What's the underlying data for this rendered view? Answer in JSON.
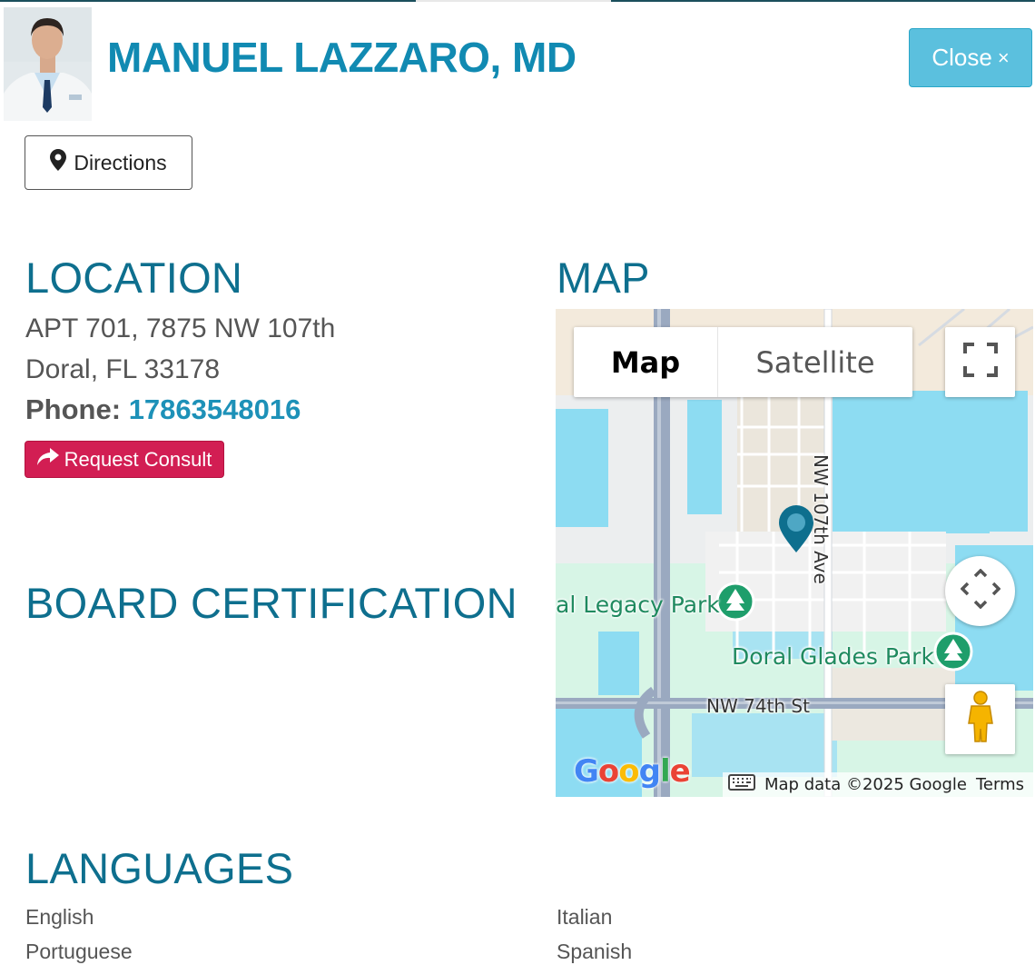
{
  "doctor": {
    "name": "MANUEL LAZZARO, MD"
  },
  "header": {
    "close_label": "Close",
    "close_icon": "×"
  },
  "actions": {
    "directions_label": "Directions",
    "consult_label": "Request Consult"
  },
  "location": {
    "title": "LOCATION",
    "address_line1": "APT 701, 7875 NW 107th",
    "address_line2": "Doral, FL 33178",
    "phone_label": "Phone:",
    "phone": "17863548016"
  },
  "board": {
    "title": "BOARD CERTIFICATION"
  },
  "map": {
    "title": "MAP",
    "type_map": "Map",
    "type_satellite": "Satellite",
    "labels": {
      "legacy_park": "al Legacy Park",
      "doral_glades_park": "Doral Glades Park",
      "nw_107th_ave": "NW 107th Ave",
      "nw_74th_st": "NW 74th St"
    },
    "footer": {
      "data": "Map data ©2025 Google",
      "terms": "Terms"
    },
    "logo": {
      "g": "G",
      "o1": "o",
      "o2": "o",
      "g2": "g",
      "l": "l",
      "e": "e"
    }
  },
  "languages": {
    "title": "LANGUAGES",
    "items": [
      "English",
      "Italian",
      "Portuguese",
      "Spanish"
    ]
  },
  "colors": {
    "name": "#118ab2",
    "section": "#0e6f8e",
    "close_bg": "#5bc0de",
    "consult_bg": "#d21e53",
    "phone_link": "#1d91b8"
  }
}
